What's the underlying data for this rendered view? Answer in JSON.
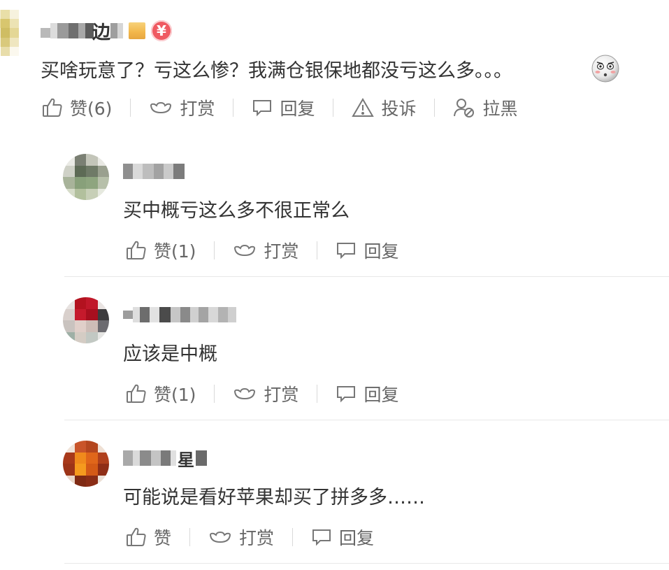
{
  "main_comment": {
    "username": "边",
    "text": "买啥玩意了？亏这么惨？我满仓银保地都没亏这么多。。。",
    "actions": {
      "like": "赞(6)",
      "tip": "打赏",
      "reply": "回复",
      "report": "投诉",
      "block": "拉黑"
    },
    "badge_money_symbol": "¥"
  },
  "replies": [
    {
      "text": "买中概亏这么多不很正常么",
      "like": "赞(1)",
      "tip": "打赏",
      "reply": "回复"
    },
    {
      "text": "应该是中概",
      "like": "赞(1)",
      "tip": "打赏",
      "reply": "回复"
    },
    {
      "username": "星",
      "text": "可能说是看好苹果却买了拼多多……",
      "like": "赞",
      "tip": "打赏",
      "reply": "回复"
    }
  ],
  "colors": {
    "text": "#333333",
    "action": "#666666",
    "badge_money": "#ef5a62",
    "badge_gold": "#f2b64a",
    "divider": "#e8e8e8"
  },
  "icons": {
    "like": "thumbs-up-icon",
    "tip": "ingot-icon",
    "reply": "comment-icon",
    "report": "warning-icon",
    "block": "block-user-icon"
  }
}
